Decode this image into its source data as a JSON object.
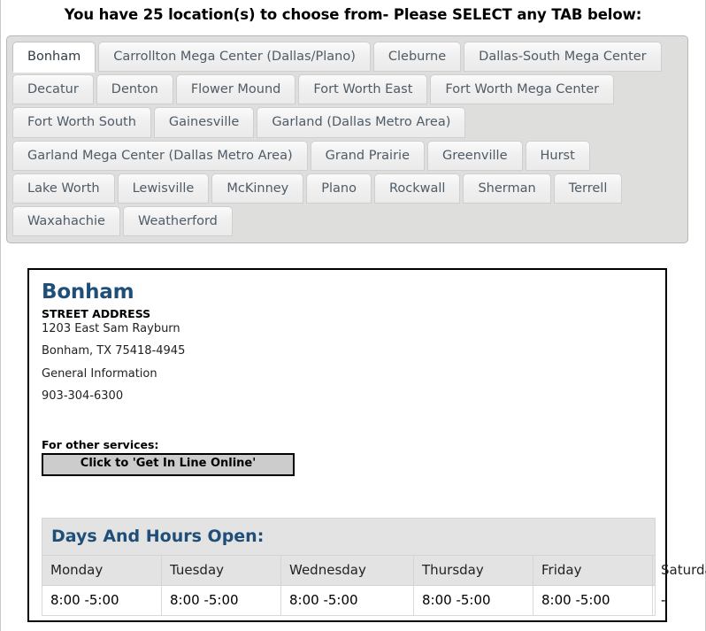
{
  "page": {
    "heading": "You have 25 location(s) to choose from- Please SELECT any TAB below:",
    "location_count": 25
  },
  "tabs": {
    "active_index": 0,
    "items": [
      {
        "label": "Bonham",
        "active": true
      },
      {
        "label": "Carrollton Mega Center (Dallas/Plano)",
        "active": false
      },
      {
        "label": "Cleburne",
        "active": false
      },
      {
        "label": "Dallas-South Mega Center",
        "active": false
      },
      {
        "label": "Decatur",
        "active": false
      },
      {
        "label": "Denton",
        "active": false
      },
      {
        "label": "Flower Mound",
        "active": false
      },
      {
        "label": "Fort Worth East",
        "active": false
      },
      {
        "label": "Fort Worth Mega Center",
        "active": false
      },
      {
        "label": "Fort Worth South",
        "active": false
      },
      {
        "label": "Gainesville",
        "active": false
      },
      {
        "label": "Garland (Dallas Metro Area)",
        "active": false
      },
      {
        "label": "Garland Mega Center (Dallas Metro Area)",
        "active": false
      },
      {
        "label": "Grand Prairie",
        "active": false
      },
      {
        "label": "Greenville",
        "active": false
      },
      {
        "label": "Hurst",
        "active": false
      },
      {
        "label": "Lake Worth",
        "active": false
      },
      {
        "label": "Lewisville",
        "active": false
      },
      {
        "label": "McKinney",
        "active": false
      },
      {
        "label": "Plano",
        "active": false
      },
      {
        "label": "Rockwall",
        "active": false
      },
      {
        "label": "Sherman",
        "active": false
      },
      {
        "label": "Terrell",
        "active": false
      },
      {
        "label": "Waxahachie",
        "active": false
      },
      {
        "label": "Weatherford",
        "active": false
      }
    ]
  },
  "panel": {
    "title": "Bonham",
    "street_address_label": "STREET ADDRESS",
    "street_address": "1203 East Sam Rayburn",
    "city_state_zip": "Bonham, TX 75418-4945",
    "phone_label": "General Information",
    "phone": "903-304-6300",
    "services_label": "For other services:",
    "get_in_line_button": "Click to 'Get In Line Online'"
  },
  "hours": {
    "caption": "Days And Hours Open:",
    "columns": [
      "Monday",
      "Tuesday",
      "Wednesday",
      "Thursday",
      "Friday",
      "Saturday"
    ],
    "rows": [
      [
        "8:00 -5:00",
        "8:00 -5:00",
        "8:00 -5:00",
        "8:00 -5:00",
        "8:00 -5:00",
        "-"
      ]
    ]
  },
  "colors": {
    "heading_blue": "#1f4e79",
    "tab_bar_bg": "#dededc",
    "tab_text": "#4f5b66",
    "button_bg": "#cccccc",
    "table_header_bg": "#e3e3e3"
  }
}
